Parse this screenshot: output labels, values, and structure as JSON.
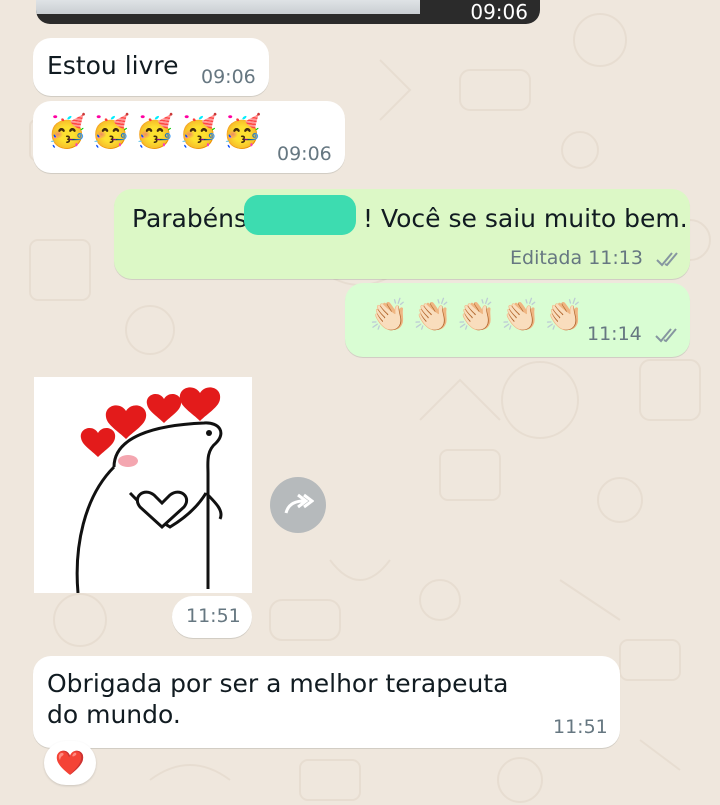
{
  "top_media": {
    "time": "09:06"
  },
  "messages": [
    {
      "text": "Estou livre",
      "time": "09:06"
    },
    {
      "emoji": [
        "🥳",
        "🥳",
        "🥳",
        "🥳",
        "🥳"
      ],
      "time": "09:06"
    },
    {
      "text_before": "Parabéns",
      "text_after": "! Você se saiu muito bem.",
      "edited_label": "Editada",
      "time": "11:13"
    },
    {
      "emoji": [
        "👏🏻",
        "👏🏻",
        "👏🏻",
        "👏🏻",
        "👏🏻"
      ],
      "time": "11:14"
    },
    {
      "sticker": "flork-heart-sticker",
      "time": "11:51"
    },
    {
      "text": "Obrigada por ser a melhor terapeuta do mundo.",
      "time": "11:51"
    }
  ],
  "reaction": {
    "emoji": "❤️"
  },
  "colors": {
    "wallpaper": "#efe7dd",
    "outgoing": "#dcf8c6",
    "incoming": "#ffffff",
    "tick": "#8696a0",
    "scribble": "#3ddcb0"
  },
  "icons": {
    "forward": "forward-icon",
    "read_receipt": "double-check-icon"
  }
}
